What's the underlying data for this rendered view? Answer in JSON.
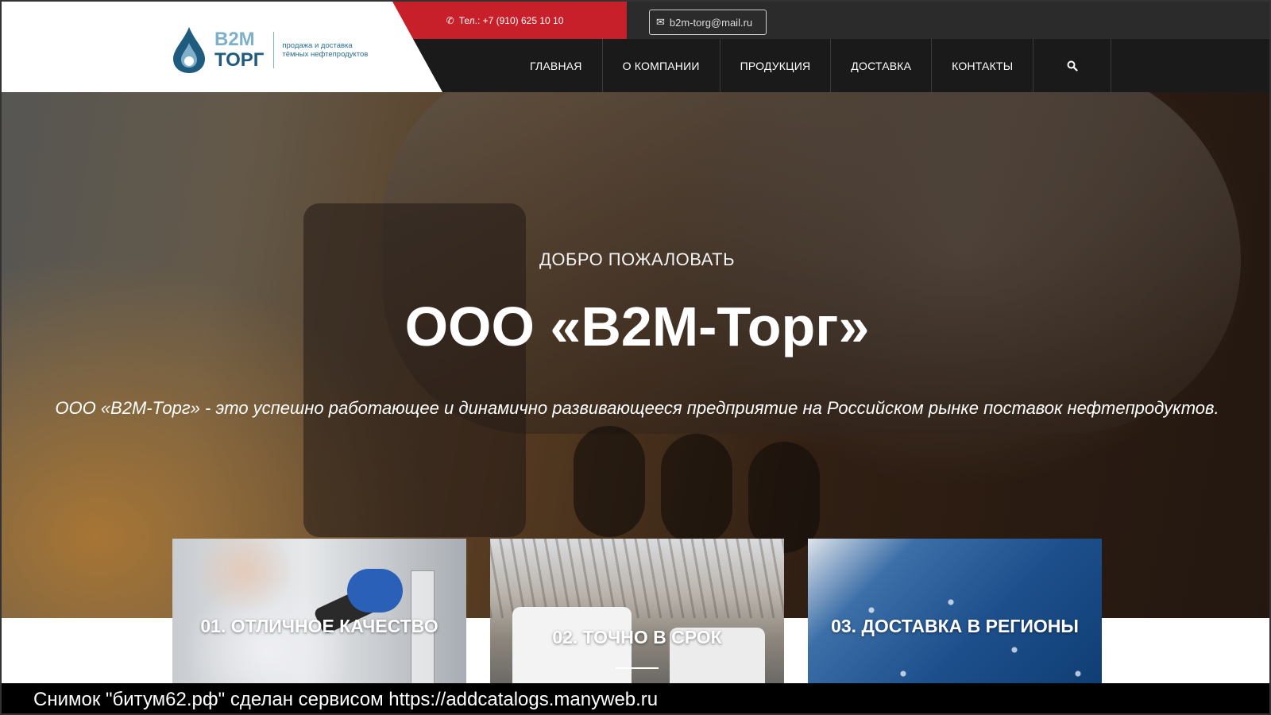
{
  "header": {
    "phone": "Тел.: +7 (910) 625 10 10",
    "email": "b2m-torg@mail.ru",
    "logo": {
      "line1": "B2M",
      "line2": "ТОРГ",
      "tagline": "продажа и доставка тёмных нефтепродуктов"
    },
    "nav": [
      {
        "label": "ГЛАВНАЯ"
      },
      {
        "label": "О КОМПАНИИ"
      },
      {
        "label": "ПРОДУКЦИЯ"
      },
      {
        "label": "ДОСТАВКА"
      },
      {
        "label": "КОНТАКТЫ"
      }
    ]
  },
  "hero": {
    "subtitle": "ДОБРО ПОЖАЛОВАТЬ",
    "title": "ООО «B2M-Торг»",
    "description": "ООО «B2M-Торг» - это успешно работающее и динамично развивающееся предприятие на Российском рынке поставок нефтепродуктов."
  },
  "features": [
    {
      "title": "01. ОТЛИЧНОЕ КАЧЕСТВО"
    },
    {
      "title": "02. ТОЧНО В СРОК"
    },
    {
      "title": "03. ДОСТАВКА В РЕГИОНЫ"
    }
  ],
  "caption": "Снимок \"битум62.рф\" сделан сервисом https://addcatalogs.manyweb.ru",
  "colors": {
    "brand_red": "#c8202a",
    "nav_bg": "#1a1a1a",
    "logo_blue": "#1e5b7e"
  }
}
